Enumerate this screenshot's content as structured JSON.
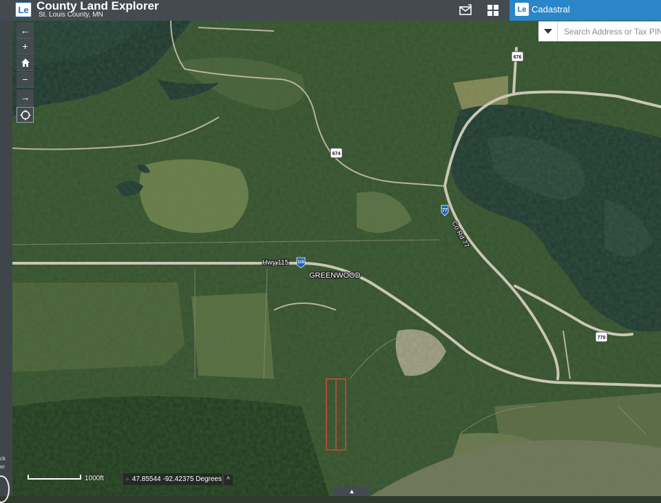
{
  "header": {
    "logo_text": "Le",
    "title": "County Land Explorer",
    "subtitle": "St. Louis County, MN",
    "contact_icon": "envelope-icon",
    "apps_icon": "grid-icon",
    "theme_label": "Cadastral",
    "theme_logo": "Le"
  },
  "left_strip": {
    "text": "ck er"
  },
  "nav": {
    "back_icon": "←",
    "zoom_in": "+",
    "home_icon": "house-icon",
    "zoom_out": "−",
    "forward_icon": "→",
    "locate_icon": "crosshair-icon"
  },
  "search": {
    "placeholder": "Search Address or Tax PIN"
  },
  "map": {
    "place_label": "GREENWOOD",
    "road_labels": {
      "hwy115": "Hwy 115",
      "cord77": "Co Rd 77"
    },
    "shields": {
      "s676": "676",
      "s674": "674",
      "s77": "77",
      "s115": "115",
      "s770": "770"
    },
    "colors": {
      "forest": "#2f4a2a",
      "water": "#1f3833",
      "road": "#c9c6b5",
      "parcel": "#e0453d",
      "shield_blue": "#1d63b4"
    }
  },
  "scale": {
    "label": "1000ft"
  },
  "coords": {
    "icon": "crosshair-small-icon",
    "text": "47.85544 -92.42375 Degrees",
    "toggle": "^"
  },
  "bottom_tab": {
    "icon": "▲"
  }
}
